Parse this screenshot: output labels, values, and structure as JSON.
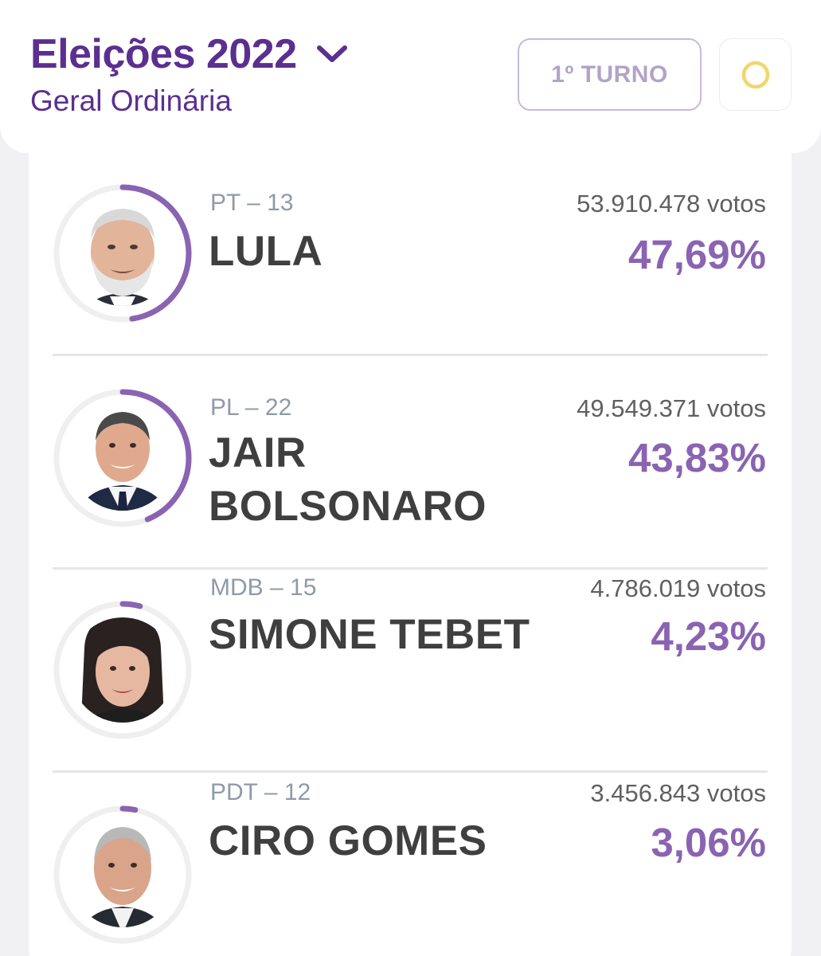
{
  "header": {
    "title": "Eleições 2022",
    "subtitle": "Geral Ordinária",
    "round_button": "1º TURNO",
    "status_indicator_color": "#f2d66b",
    "icons": {
      "dropdown": "chevron-down-icon",
      "status": "circle-icon"
    }
  },
  "colors": {
    "brand": "#5b2f8f",
    "accent": "#8a63b2",
    "ring_track": "#efefef",
    "muted_button": "#b3a3c7"
  },
  "candidates": [
    {
      "party": "PT – 13",
      "name": "LULA",
      "votes": "53.910.478 votos",
      "percent": "47,69%",
      "share": 0.4769
    },
    {
      "party": "PL – 22",
      "name": "JAIR BOLSONARO",
      "votes": "49.549.371 votos",
      "percent": "43,83%",
      "share": 0.4383
    },
    {
      "party": "MDB – 15",
      "name": "SIMONE TEBET",
      "votes": "4.786.019 votos",
      "percent": "4,23%",
      "share": 0.0423
    },
    {
      "party": "PDT – 12",
      "name": "CIRO GOMES",
      "votes": "3.456.843 votos",
      "percent": "3,06%",
      "share": 0.0306
    }
  ]
}
